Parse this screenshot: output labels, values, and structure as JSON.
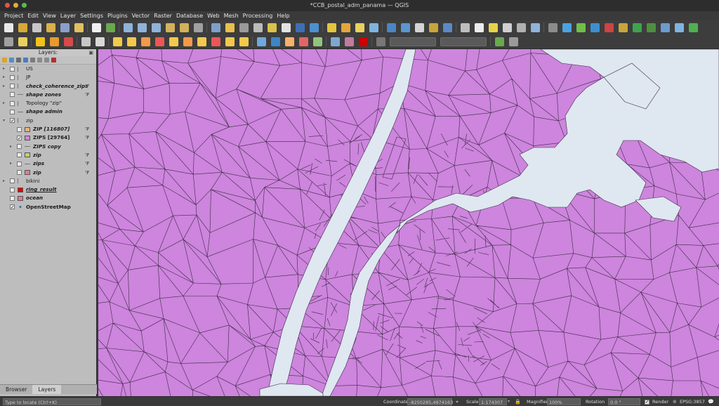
{
  "window": {
    "title": "*CCB_postal_adm_panama — QGIS"
  },
  "menu": [
    "Project",
    "Edit",
    "View",
    "Layer",
    "Settings",
    "Plugins",
    "Vector",
    "Raster",
    "Database",
    "Web",
    "Mesh",
    "Processing",
    "Help"
  ],
  "layers_panel": {
    "title": "Layers",
    "tabs": [
      "Browser",
      "Layers"
    ],
    "items": [
      {
        "name": "US",
        "style": "",
        "checked": false,
        "symbol": "group",
        "level": 0
      },
      {
        "name": "JP",
        "style": "",
        "checked": false,
        "symbol": "group",
        "level": 0
      },
      {
        "name": "check_coherence_zips",
        "style": "bold-italic",
        "checked": false,
        "symbol": "group",
        "level": 0
      },
      {
        "name": "shape zones",
        "style": "bold-italic",
        "checked": false,
        "symbol": "line",
        "level": 0
      },
      {
        "name": "Topology \"zip\"",
        "style": "",
        "checked": false,
        "symbol": "group",
        "level": 0
      },
      {
        "name": "shape admin",
        "style": "bold-italic",
        "checked": false,
        "symbol": "line",
        "level": 0
      },
      {
        "name": "zip",
        "style": "",
        "checked": true,
        "symbol": "group",
        "level": 0
      },
      {
        "name": "ZIP [116807]",
        "style": "bold-italic",
        "checked": false,
        "symbol": "fill",
        "color": "#e6b380",
        "level": 1
      },
      {
        "name": "ZIPS [29764]",
        "style": "bold",
        "checked": true,
        "symbol": "fill",
        "color": "#cd85dd",
        "level": 1
      },
      {
        "name": "ZIPS copy",
        "style": "bold-italic",
        "checked": false,
        "symbol": "line",
        "level": 1
      },
      {
        "name": "zip",
        "style": "bold-italic",
        "checked": false,
        "symbol": "fill",
        "color": "#b8d36b",
        "level": 1
      },
      {
        "name": "zips",
        "style": "bold-italic",
        "checked": false,
        "symbol": "line",
        "level": 1
      },
      {
        "name": "zip",
        "style": "bold-italic",
        "checked": false,
        "symbol": "fill",
        "color": "#e37b8f",
        "level": 1
      },
      {
        "name": "bikini",
        "style": "",
        "checked": false,
        "symbol": "group",
        "level": 0
      },
      {
        "name": "ring_result",
        "style": "bold-italic",
        "checked": false,
        "symbol": "fill",
        "color": "#e00000",
        "level": 0
      },
      {
        "name": "ocean",
        "style": "bold-italic",
        "checked": false,
        "symbol": "fill",
        "color": "#e27b96",
        "level": 0
      },
      {
        "name": "OpenStreetMap",
        "style": "bold",
        "checked": true,
        "symbol": "tile",
        "level": 0
      }
    ]
  },
  "map": {
    "fill_color": "#cd85dd",
    "water_color": "#dfe7f1",
    "border_color": "#3d2a45"
  },
  "statusbar": {
    "locator_placeholder": "Type to locate (Ctrl+K)",
    "coordinate_label": "Coordinate",
    "coordinate": "-8250285,4974163",
    "scale_label": "Scale",
    "scale": "1:174307",
    "magnifier_label": "Magnifier",
    "magnifier": "100%",
    "rotation_label": "Rotation",
    "rotation": "0.0 °",
    "render_label": "Render",
    "crs": "EPSG:3857"
  }
}
